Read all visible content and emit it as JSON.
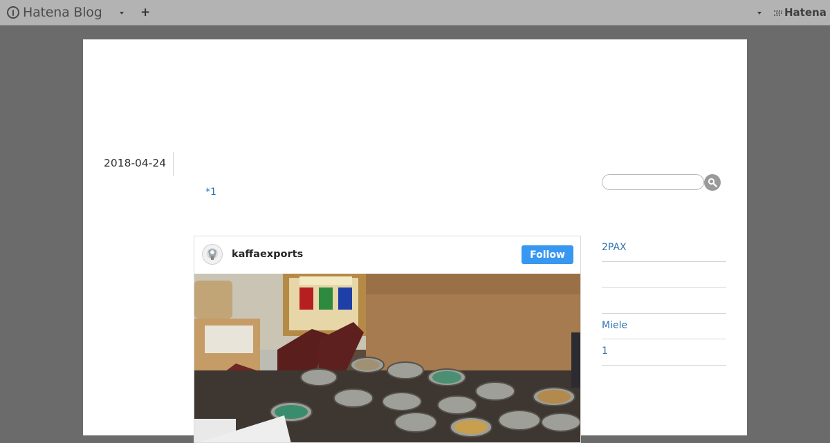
{
  "topbar": {
    "brand": "Hatena Blog",
    "add_label": "+",
    "hatena_logo": "Hatena",
    "icons": [
      "hatena-blog-logo-icon",
      "chevron-down-icon",
      "plus-icon",
      "hatena-logo-icon"
    ]
  },
  "article": {
    "date": "2018-04-24",
    "footnote": "*1"
  },
  "instagram": {
    "username": "kaffaexports",
    "follow_label": "Follow",
    "follow_color": "#3897f0"
  },
  "sidebar": {
    "search_placeholder": "",
    "items": [
      {
        "label": "2PAX"
      },
      {
        "label": ""
      },
      {
        "label": ""
      },
      {
        "label": "Miele"
      },
      {
        "label": "1"
      }
    ]
  },
  "colors": {
    "page_background": "#6b6b6b",
    "topbar": "#b3b3b3",
    "link": "#2f74b0"
  }
}
